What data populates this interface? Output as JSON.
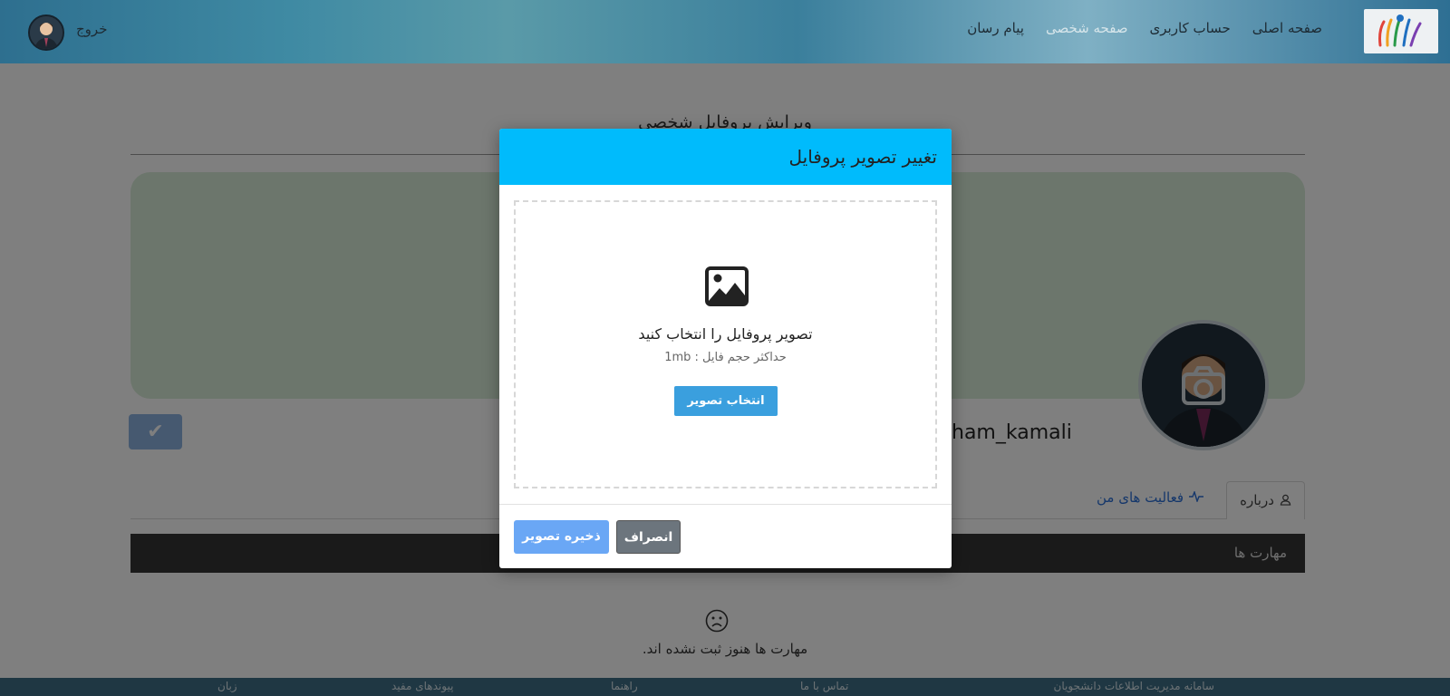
{
  "nav": {
    "links": [
      "صفحه اصلی",
      "حساب کاربری",
      "صفحه شخصی",
      "پیام رسان"
    ],
    "active_index": 2,
    "logout_label": "خروج",
    "logo_icon": "university-logo-icon",
    "avatar_icon": "user-avatar-icon"
  },
  "page": {
    "title": "ویرایش پروفایل شخصی",
    "username": "ham_kamali",
    "confirm_icon": "checkmark-icon",
    "tabs": [
      {
        "label": "درباره",
        "icon": "user-icon"
      },
      {
        "label": "فعالیت های من",
        "icon": "activity-icon"
      }
    ],
    "skills_header": "مهارت ها",
    "skills_empty_text": "مهارت ها هنوز ثبت نشده اند.",
    "skills_empty_icon": "sad-face-icon"
  },
  "footer": {
    "items": [
      "سامانه مدیریت اطلاعات دانشجویان",
      "تماس با ما",
      "راهنما",
      "پیوندهای مفید",
      "زبان"
    ]
  },
  "modal": {
    "title": "تغییر تصویر پروفایل",
    "dropzone_icon": "image-icon",
    "dropzone_title": "تصویر پروفایل را انتخاب کنید",
    "dropzone_subtitle": "حداکثر حجم فایل : 1mb",
    "choose_button": "انتخاب تصویر",
    "cancel_button": "انصراف",
    "save_button": "ذخیره تصویر"
  },
  "colors": {
    "modal_header": "#00bbfc",
    "choose_button": "#3a9fde",
    "save_button": "#6aa7f5",
    "cancel_button": "#6c757d",
    "skills_bar": "#353535"
  }
}
